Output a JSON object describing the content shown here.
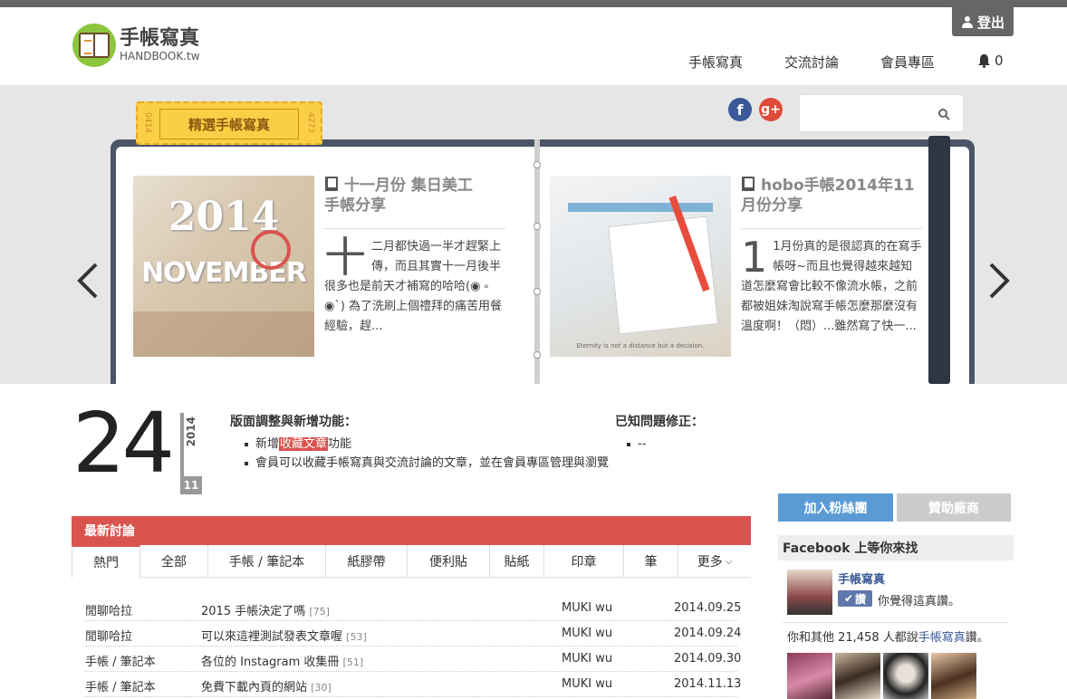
{
  "header": {
    "logo_cn": "手帳寫真",
    "logo_en": "HANDBOOK.tw",
    "logout": "登出",
    "nav": [
      "手帳寫真",
      "交流討論",
      "會員專區"
    ],
    "notification_count": "0"
  },
  "hero": {
    "search_placeholder": "",
    "tag_label": "精選手帳寫真",
    "tag_numbers": [
      "0414",
      "4273"
    ],
    "articles": [
      {
        "title": "十一月份 集日美工手帳分享",
        "drop": "十",
        "body": "二月都快過一半才趕緊上傳，而且其實十一月後半很多也是前天才補寫的哈哈(◉ ༚ ◉`) 為了洗刷上個禮拜的痛苦用餐經驗，趕...",
        "image_text": [
          "2014",
          "NOVEMBER"
        ]
      },
      {
        "title": "hobo手帳2014年11月份分享",
        "drop": "1",
        "body": "1月份真的是很認真的在寫手帳呀~而且也覺得越來越知道怎麼寫會比較不像流水帳，之前都被姐妹淘說寫手帳怎麼那麼沒有溫度啊！（悶）...雖然寫了快一...",
        "image_text": [
          "Eternity is not a distance but a decision."
        ]
      }
    ]
  },
  "date": {
    "day": "24",
    "year": "2014",
    "month": "11"
  },
  "notes": {
    "features_title": "版面調整與新增功能：",
    "feature_1_pre": "新增",
    "feature_1_hl": "收藏文章",
    "feature_1_post": "功能",
    "feature_2": "會員可以收藏手帳寫真與交流討論的文章，並在會員專區管理與瀏覽",
    "fixes_title": "已知問題修正：",
    "fix_1": "--"
  },
  "discussion": {
    "title": "最新討論",
    "tabs": [
      "熱門",
      "全部",
      "手帳 / 筆記本",
      "紙膠帶",
      "便利貼",
      "貼紙",
      "印章",
      "筆",
      "更多"
    ],
    "rows": [
      {
        "category": "閒聊哈拉",
        "title": "2015 手帳決定了嗎",
        "count": "[75]",
        "author": "MUKI wu",
        "date": "2014.09.25"
      },
      {
        "category": "閒聊哈拉",
        "title": "可以來這裡測試發表文章喔",
        "count": "[53]",
        "author": "MUKI wu",
        "date": "2014.09.24"
      },
      {
        "category": "手帳 / 筆記本",
        "title": "各位的 Instagram 收集冊",
        "count": "[51]",
        "author": "MUKI wu",
        "date": "2014.09.30"
      },
      {
        "category": "手帳 / 筆記本",
        "title": "免費下載內頁的網站",
        "count": "[30]",
        "author": "MUKI wu",
        "date": "2014.11.13"
      }
    ]
  },
  "sidebar": {
    "join_fans": "加入粉絲團",
    "sponsors": "贊助廠商",
    "fb_title": "Facebook 上等你來找",
    "page_name": "手帳寫真",
    "like_btn": "讚",
    "like_text": "你覺得這真讚。",
    "count_pre": "你和其他 21,458 人都說",
    "count_name": "手帳寫真",
    "count_post": "讚。"
  },
  "colors": {
    "accent_red": "#d9534f",
    "fb_blue": "#3b5998",
    "button_blue": "#5b9bd5",
    "button_gray": "#cccccc"
  }
}
